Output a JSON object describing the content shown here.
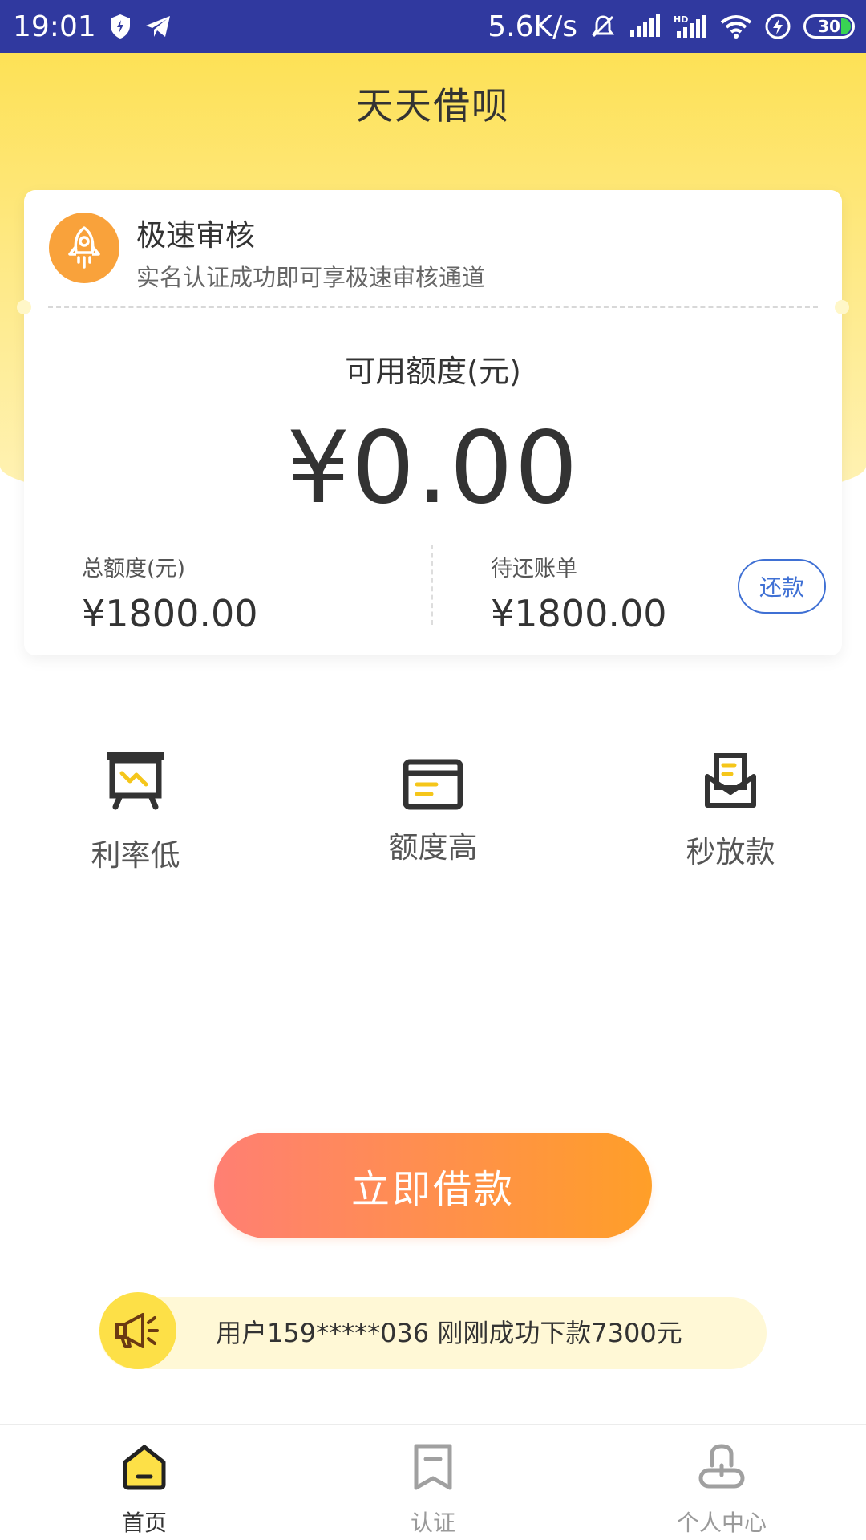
{
  "status_bar": {
    "time": "19:01",
    "net_speed": "5.6K/s",
    "battery": "30",
    "icons": [
      "shield-icon",
      "telegram-icon",
      "mute-icon",
      "signal-icon",
      "hd-signal-icon",
      "wifi-icon",
      "charging-icon",
      "battery-icon"
    ]
  },
  "header": {
    "title": "天天借呗"
  },
  "promo": {
    "title": "极速审核",
    "subtitle": "实名认证成功即可享极速审核通道",
    "icon": "rocket-icon"
  },
  "credit": {
    "available_label": "可用额度(元)",
    "available_value": "¥0.00",
    "total_label": "总额度(元)",
    "total_value": "¥1800.00",
    "bill_label": "待还账单",
    "bill_value": "¥1800.00",
    "repay_button": "还款"
  },
  "features": [
    {
      "label": "利率低",
      "icon": "presentation-chart-icon"
    },
    {
      "label": "额度高",
      "icon": "card-icon"
    },
    {
      "label": "秒放款",
      "icon": "inbox-document-icon"
    }
  ],
  "cta": {
    "label": "立即借款"
  },
  "notice": {
    "text": "用户159*****036 刚刚成功下款7300元",
    "icon": "megaphone-icon"
  },
  "tabs": [
    {
      "label": "首页",
      "icon": "home-icon",
      "active": true
    },
    {
      "label": "认证",
      "icon": "bookmark-icon",
      "active": false
    },
    {
      "label": "个人中心",
      "icon": "user-icon",
      "active": false
    }
  ],
  "colors": {
    "status_bar": "#30399f",
    "header_yellow": "#fde156",
    "accent_orange": "#f9a23b",
    "repay_blue": "#3f70d4",
    "cta_start": "#ff7f73",
    "cta_end": "#ff9f28",
    "notice_bg": "#fff8d6"
  }
}
